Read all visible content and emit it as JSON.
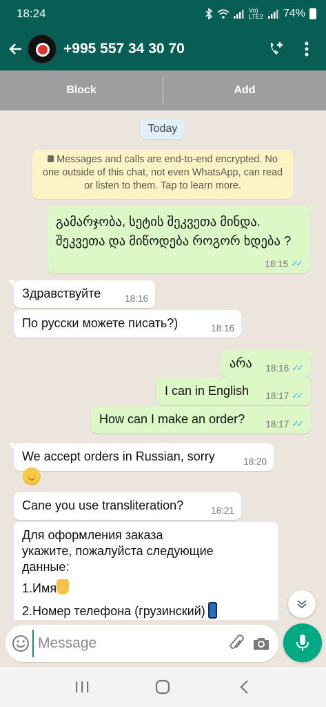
{
  "status_bar": {
    "time": "18:24",
    "network_label": "Vo) LTE2",
    "battery": "74%",
    "icons": [
      "bluetooth-icon",
      "wifi-icon",
      "signal-icon",
      "signal-icon",
      "battery-icon"
    ]
  },
  "header": {
    "contact": "+995 557 34 30 70",
    "icons": [
      "back-arrow-icon",
      "add-call-icon",
      "more-vert-icon"
    ]
  },
  "actions": {
    "block_label": "Block",
    "add_label": "Add"
  },
  "chat": {
    "date_chip": "Today",
    "encryption_notice": "Messages and calls are end-to-end encrypted. No one outside of this chat, not even WhatsApp, can read or listen to them. Tap to learn more.",
    "messages": [
      {
        "dir": "out",
        "text": "გამარჯობა, სეტის შეკვეთა მინდა. შეკვეთა და მიწოდება როგორ ხდება ?",
        "time": "18:15",
        "read": true
      },
      {
        "dir": "in",
        "text": "Здравствуйте",
        "time": "18:16"
      },
      {
        "dir": "in",
        "text": "По русски можете писать?)",
        "time": "18:16"
      },
      {
        "dir": "out",
        "text": "არა",
        "time": "18:16",
        "read": true
      },
      {
        "dir": "out",
        "text": "I can in English",
        "time": "18:17",
        "read": true
      },
      {
        "dir": "out",
        "text": "How can I make an order?",
        "time": "18:17",
        "read": true
      },
      {
        "dir": "in",
        "text": "We accept orders in Russian, sorry",
        "time": "18:20"
      },
      {
        "dir": "in",
        "text": "Cane you use transliteration?",
        "time": "18:21"
      },
      {
        "dir": "in",
        "line1": "Для оформления заказа",
        "line2": "укажите, пожалуйста  следующие",
        "line3": "данные:",
        "line4": "1.Имя",
        "line5": "2.Номер телефона (грузинский)"
      }
    ]
  },
  "input": {
    "placeholder": "Message",
    "icons": [
      "emoji-icon",
      "attach-icon",
      "camera-icon",
      "mic-icon"
    ]
  },
  "nav": {
    "icons": [
      "recent-apps-icon",
      "home-icon",
      "back-icon"
    ]
  },
  "colors": {
    "header": "#075E54",
    "outgoing_bubble": "#DCF8C6",
    "incoming_bubble": "#FFFFFF",
    "chat_bg": "#ECE5DD",
    "read_ticks": "#34B7F1",
    "mic_button": "#00A884"
  }
}
